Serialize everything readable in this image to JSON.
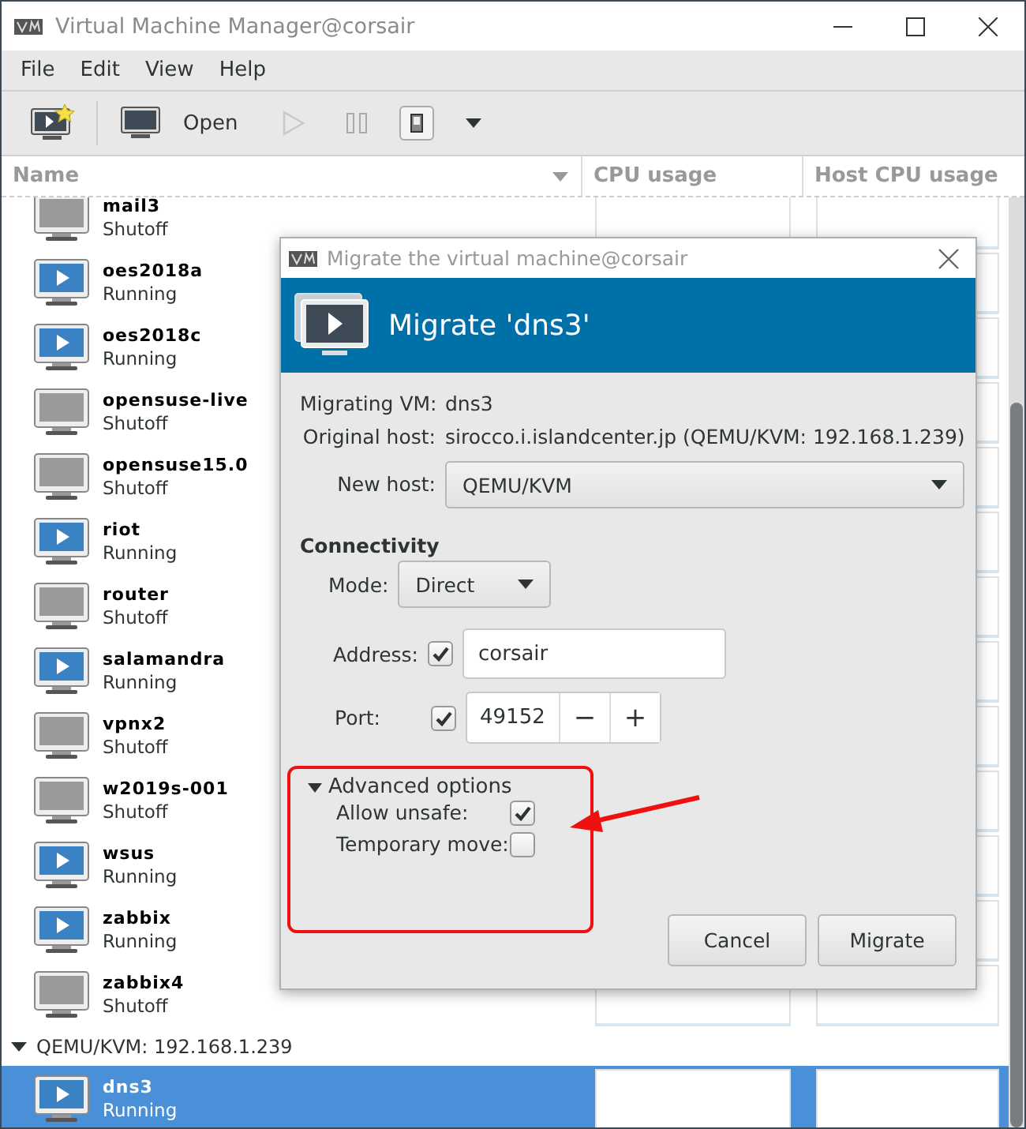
{
  "window": {
    "title": "Virtual Machine Manager@corsair"
  },
  "menu": [
    "File",
    "Edit",
    "View",
    "Help"
  ],
  "toolbar": {
    "open_label": "Open"
  },
  "columns": [
    "Name",
    "CPU usage",
    "Host CPU usage"
  ],
  "vms": [
    {
      "name": "mail3",
      "status": "Shutoff",
      "running": false,
      "selected": false
    },
    {
      "name": "oes2018a",
      "status": "Running",
      "running": true,
      "selected": false
    },
    {
      "name": "oes2018c",
      "status": "Running",
      "running": true,
      "selected": false
    },
    {
      "name": "opensuse-live",
      "status": "Shutoff",
      "running": false,
      "selected": false
    },
    {
      "name": "opensuse15.0",
      "status": "Shutoff",
      "running": false,
      "selected": false
    },
    {
      "name": "riot",
      "status": "Running",
      "running": true,
      "selected": false
    },
    {
      "name": "router",
      "status": "Shutoff",
      "running": false,
      "selected": false
    },
    {
      "name": "salamandra",
      "status": "Running",
      "running": true,
      "selected": false
    },
    {
      "name": "vpnx2",
      "status": "Shutoff",
      "running": false,
      "selected": false
    },
    {
      "name": "w2019s-001",
      "status": "Shutoff",
      "running": false,
      "selected": false
    },
    {
      "name": "wsus",
      "status": "Running",
      "running": true,
      "selected": false
    },
    {
      "name": "zabbix",
      "status": "Running",
      "running": true,
      "selected": false
    },
    {
      "name": "zabbix4",
      "status": "Shutoff",
      "running": false,
      "selected": false
    }
  ],
  "group": {
    "label": "QEMU/KVM: 192.168.1.239",
    "expanded": true,
    "vms": [
      {
        "name": "dns3",
        "status": "Running",
        "running": true,
        "selected": true
      }
    ]
  },
  "dialog": {
    "title": "Migrate the virtual machine@corsair",
    "heading": "Migrate 'dns3'",
    "migrating_vm": {
      "label": "Migrating VM:",
      "value": "dns3"
    },
    "original_host": {
      "label": "Original host:",
      "value": "sirocco.i.islandcenter.jp (QEMU/KVM: 192.168.1.239)"
    },
    "new_host": {
      "label": "New host:",
      "value": "QEMU/KVM"
    },
    "connectivity": "Connectivity",
    "mode": {
      "label": "Mode:",
      "value": "Direct"
    },
    "address": {
      "label": "Address:",
      "checked": true,
      "value": "corsair"
    },
    "port": {
      "label": "Port:",
      "checked": true,
      "value": "49152",
      "minus": "−",
      "plus": "+"
    },
    "advanced": {
      "label": "Advanced options",
      "expanded": true,
      "options": [
        {
          "label": "Allow unsafe:",
          "checked": true
        },
        {
          "label": "Temporary move:",
          "checked": false
        }
      ]
    },
    "buttons": [
      "Cancel",
      "Migrate"
    ]
  }
}
